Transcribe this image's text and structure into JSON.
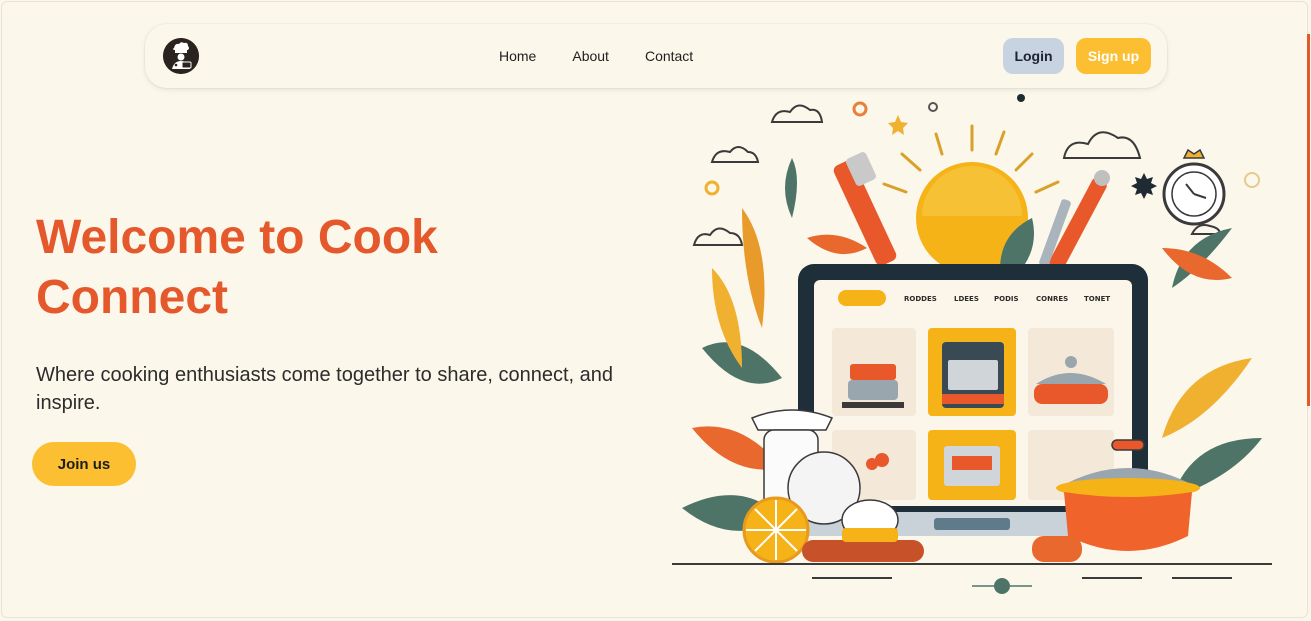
{
  "nav": {
    "links": [
      {
        "label": "Home"
      },
      {
        "label": "About"
      },
      {
        "label": "Contact"
      }
    ],
    "login_label": "Login",
    "signup_label": "Sign up"
  },
  "hero": {
    "title": "Welcome to Cook Connect",
    "subtitle": "Where cooking enthusiasts come together to share, connect, and inspire.",
    "cta_label": "Join us"
  },
  "illustration": {
    "nav_items": [
      "RODDES",
      "LDEES",
      "PODIS",
      "CONRES",
      "TONET"
    ]
  },
  "colors": {
    "accent": "#e4582c",
    "primary_button": "#fbbf31",
    "login_button": "#c7d3e0",
    "background": "#fbf7ea"
  },
  "icons": {
    "logo": "chef-logo-icon"
  }
}
